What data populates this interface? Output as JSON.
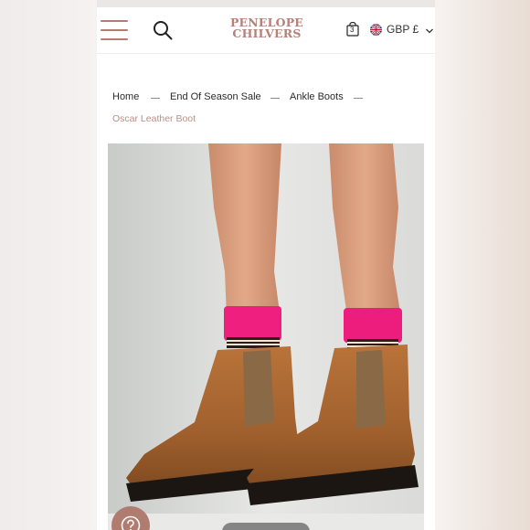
{
  "header": {
    "logo_line1": "PENELOPE",
    "logo_line2": "CHILVERS",
    "bag_count": "3",
    "currency": "GBP £"
  },
  "breadcrumb": {
    "items": [
      "Home",
      "End Of Season Sale",
      "Ankle Boots"
    ],
    "current": "Oscar Leather Boot"
  },
  "product": {
    "image_alt": "Oscar Leather Boot"
  },
  "icons": {
    "menu": "hamburger-menu-icon",
    "search": "search-icon",
    "bag": "shopping-bag-icon",
    "flag": "uk-flag-icon",
    "dropdown": "chevron-down-icon",
    "help": "question-mark-icon"
  },
  "colors": {
    "brand": "#b5827a",
    "breadcrumb_current": "#b69188",
    "help_button": "#b07c70"
  }
}
